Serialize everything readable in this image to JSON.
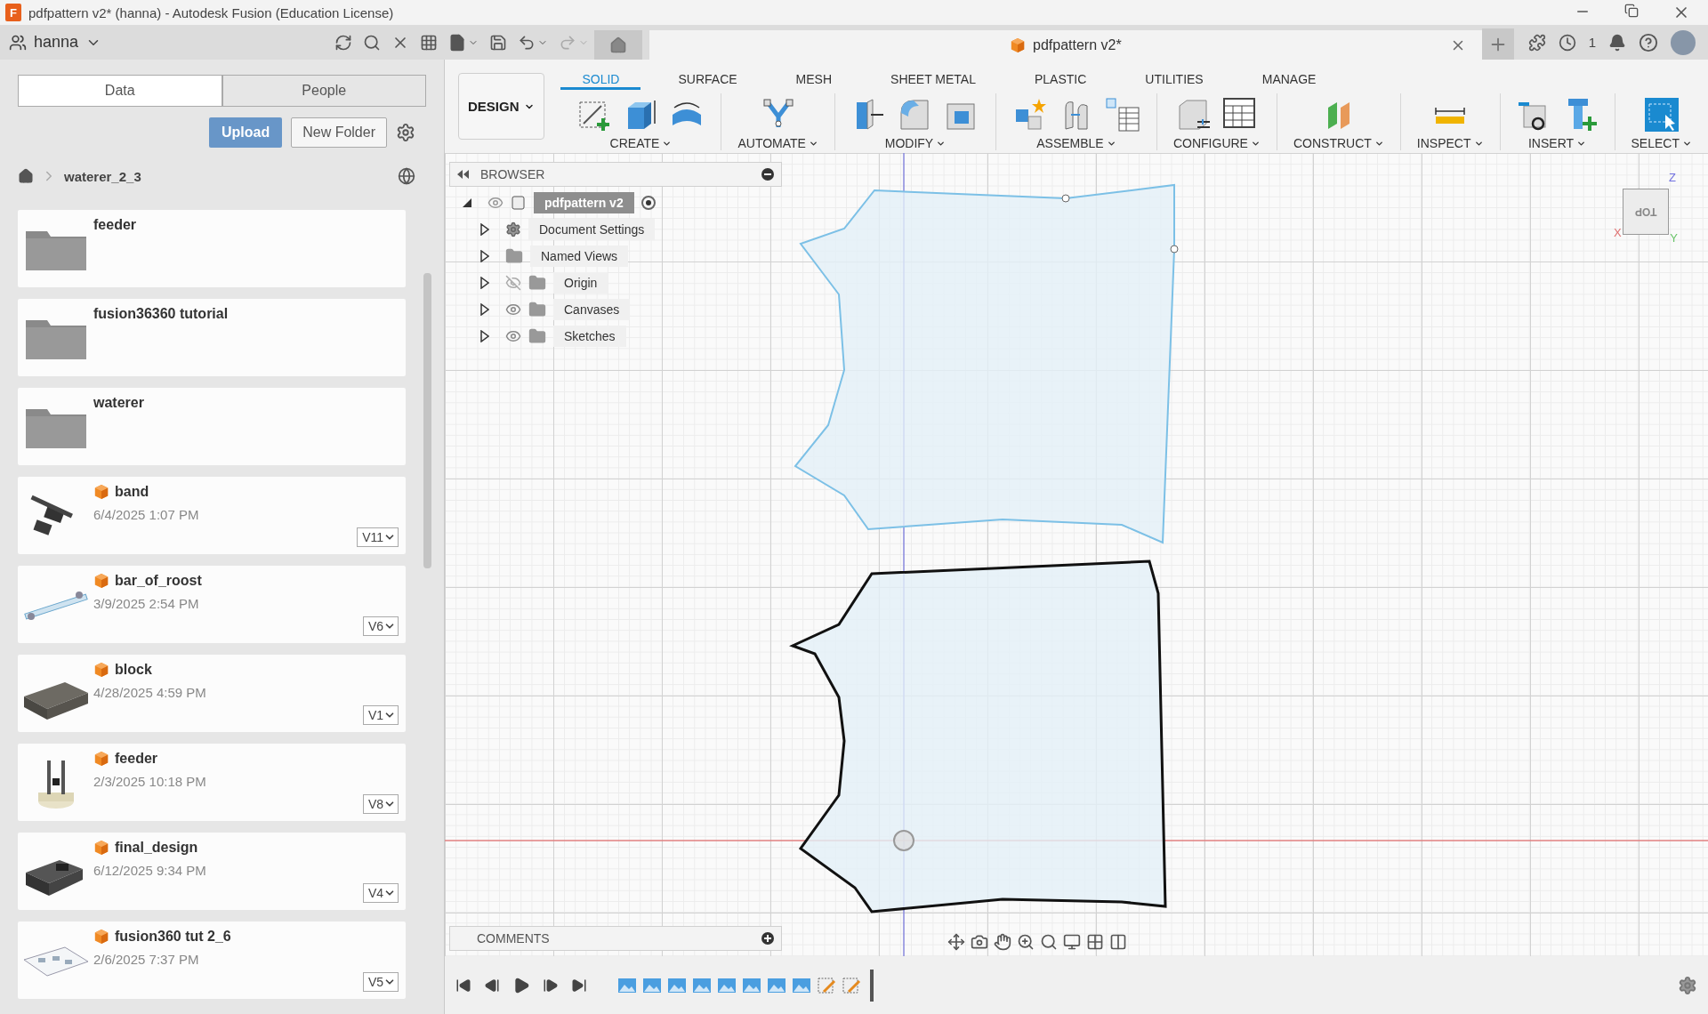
{
  "window": {
    "title": "pdfpattern v2* (hanna) - Autodesk Fusion (Education License)",
    "app_badge": "F"
  },
  "top_bar": {
    "team": "hanna",
    "document_tab": "pdfpattern v2*",
    "job_count": "1"
  },
  "data_panel": {
    "tabs": [
      {
        "label": "Data",
        "selected": true
      },
      {
        "label": "People",
        "selected": false
      }
    ],
    "upload": "Upload",
    "new_folder": "New Folder",
    "breadcrumb": "waterer_2_3",
    "items": [
      {
        "kind": "folder",
        "name": "feeder"
      },
      {
        "kind": "folder",
        "name": "fusion36360 tutorial"
      },
      {
        "kind": "folder",
        "name": "waterer"
      },
      {
        "kind": "design",
        "name": "band",
        "date": "6/4/2025 1:07 PM",
        "version": "V11"
      },
      {
        "kind": "design",
        "name": "bar_of_roost",
        "date": "3/9/2025 2:54 PM",
        "version": "V6"
      },
      {
        "kind": "design",
        "name": "block",
        "date": "4/28/2025 4:59 PM",
        "version": "V1"
      },
      {
        "kind": "design",
        "name": "feeder",
        "date": "2/3/2025 10:18 PM",
        "version": "V8"
      },
      {
        "kind": "design",
        "name": "final_design",
        "date": "6/12/2025 9:34 PM",
        "version": "V4"
      },
      {
        "kind": "design",
        "name": "fusion360 tut 2_6",
        "date": "2/6/2025 7:37 PM",
        "version": "V5"
      }
    ]
  },
  "toolbar": {
    "workspace": "DESIGN",
    "tabs": [
      {
        "label": "SOLID",
        "selected": true
      },
      {
        "label": "SURFACE",
        "selected": false
      },
      {
        "label": "MESH",
        "selected": false
      },
      {
        "label": "SHEET METAL",
        "selected": false
      },
      {
        "label": "PLASTIC",
        "selected": false
      },
      {
        "label": "UTILITIES",
        "selected": false
      },
      {
        "label": "MANAGE",
        "selected": false
      }
    ],
    "groups": [
      {
        "label": "CREATE"
      },
      {
        "label": "AUTOMATE"
      },
      {
        "label": "MODIFY"
      },
      {
        "label": "ASSEMBLE"
      },
      {
        "label": "CONFIGURE"
      },
      {
        "label": "CONSTRUCT"
      },
      {
        "label": "INSPECT"
      },
      {
        "label": "INSERT"
      },
      {
        "label": "SELECT"
      }
    ]
  },
  "browser": {
    "title": "BROWSER",
    "root": {
      "label": "pdfpattern v2",
      "active": true,
      "selected": true
    },
    "items": [
      {
        "label": "Document Settings",
        "kind": "settings",
        "selected": false
      },
      {
        "label": "Named Views",
        "kind": "folder",
        "selected": false
      },
      {
        "label": "Origin",
        "kind": "layer",
        "visible": false,
        "selected": false
      },
      {
        "label": "Canvases",
        "kind": "layer",
        "visible": true,
        "selected": false
      },
      {
        "label": "Sketches",
        "kind": "layer",
        "visible": true,
        "selected": false
      }
    ]
  },
  "view_cube": {
    "face": "TOP",
    "axes": [
      "X",
      "Y",
      "Z"
    ]
  },
  "comments": {
    "title": "COMMENTS"
  },
  "timeline": {
    "features": [
      {
        "kind": "canvas"
      },
      {
        "kind": "canvas"
      },
      {
        "kind": "canvas"
      },
      {
        "kind": "canvas"
      },
      {
        "kind": "canvas"
      },
      {
        "kind": "canvas"
      },
      {
        "kind": "canvas"
      },
      {
        "kind": "canvas"
      },
      {
        "kind": "sketch"
      },
      {
        "kind": "sketch"
      }
    ]
  }
}
